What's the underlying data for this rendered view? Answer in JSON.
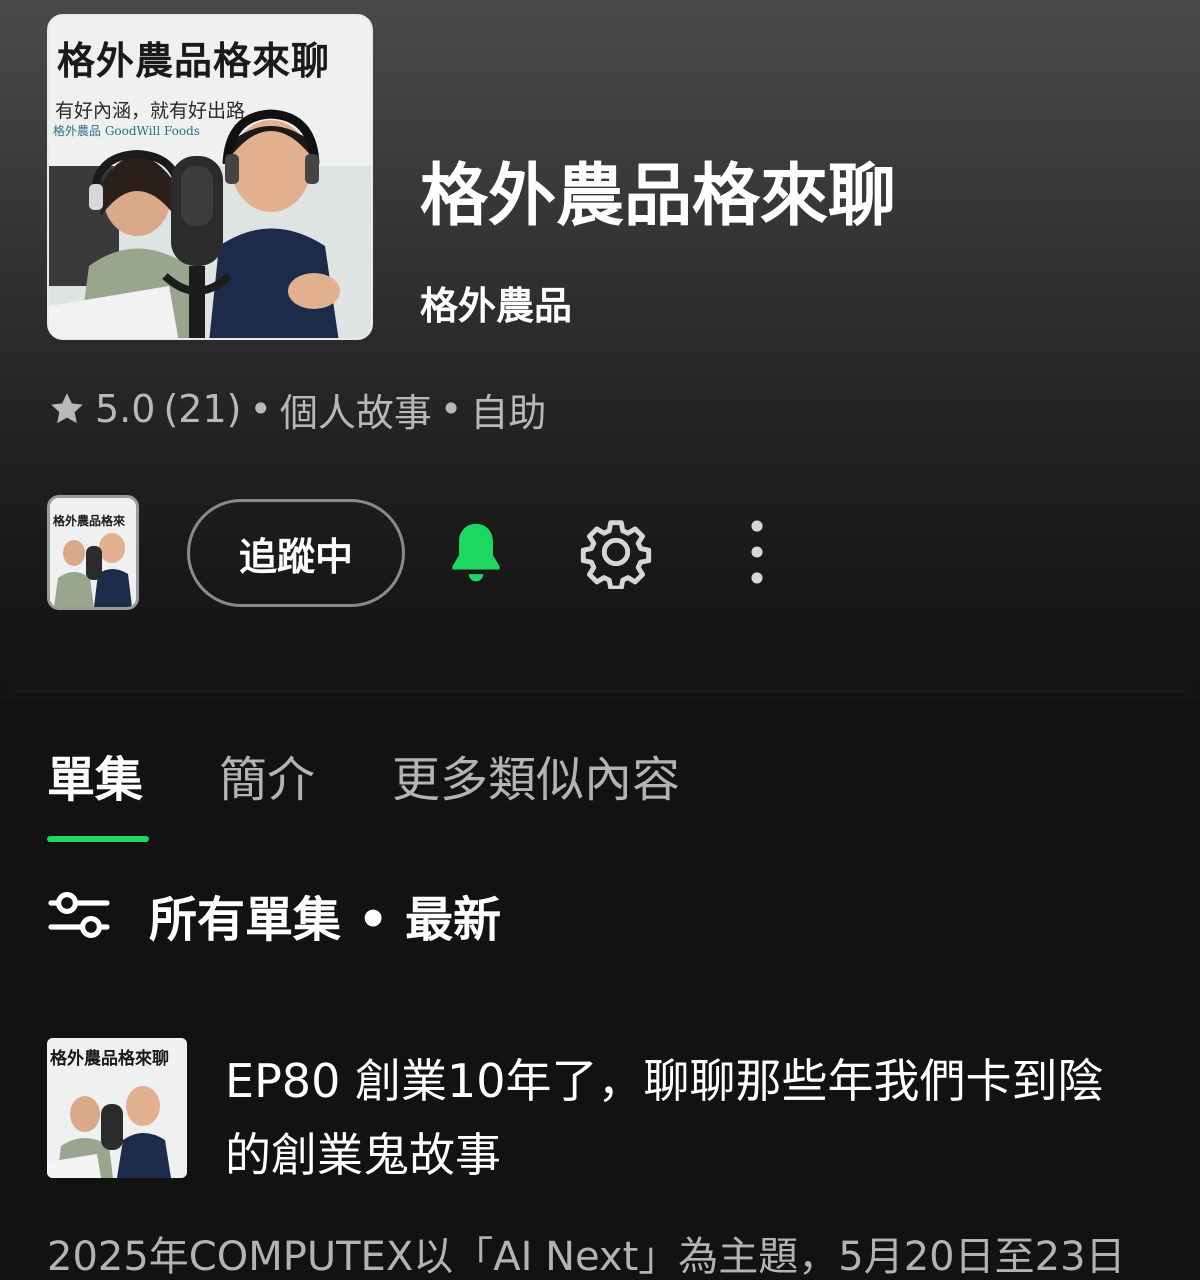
{
  "podcast": {
    "title": "格外農品格來聊",
    "publisher": "格外農品",
    "cover": {
      "title": "格外農品格來聊",
      "subtitle": "有好內涵，就有好出路",
      "brand": "格外農品 GoodWill Foods"
    }
  },
  "meta": {
    "rating": "5.0",
    "rating_count": "(21)",
    "separator": "•",
    "category_1": "個人故事",
    "category_2": "自助"
  },
  "actions": {
    "follow_label": "追蹤中",
    "mini_cover_title": "格外農品格來"
  },
  "colors": {
    "accent": "#1ed760",
    "background": "#121212"
  },
  "icons": {
    "star": "star-icon",
    "bell": "bell-icon",
    "settings": "gear-icon",
    "more": "more-vertical-icon",
    "filter": "sliders-icon"
  },
  "tabs": [
    {
      "label": "單集",
      "active": true
    },
    {
      "label": "簡介",
      "active": false
    },
    {
      "label": "更多類似內容",
      "active": false
    }
  ],
  "filter": {
    "label": "所有單集 • 最新"
  },
  "episodes": [
    {
      "thumb_title": "格外農品格來聊",
      "title": "EP80 創業10年了，聊聊那些年我們卡到陰的創業鬼故事",
      "description": "2025年COMPUTEX以「AI Next」為主題，5月20日至23日"
    }
  ]
}
